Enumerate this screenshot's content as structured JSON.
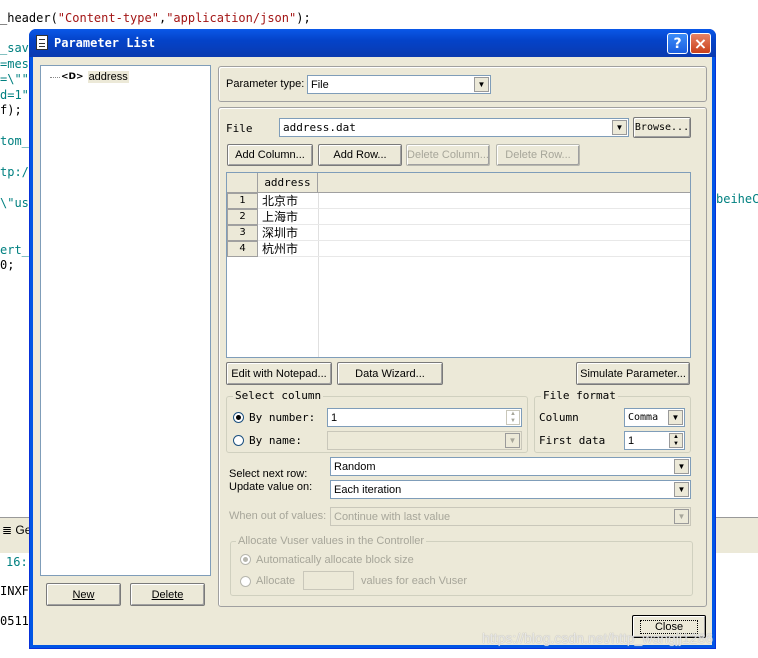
{
  "background_code": {
    "line1_prefix": "_header(",
    "line1_str1": "\"Content-type\"",
    "line1_comma": ",",
    "line1_str2": "\"application/json\"",
    "line1_suffix": ");",
    "lines": [
      "_sav",
      "=mes",
      "=\\\"\"",
      "d=1\"",
      "f);",
      "",
      "tom_",
      "",
      "tp:/",
      "",
      "\\\"us",
      "",
      "",
      "ert_",
      "0;"
    ],
    "right_fragment": "beiheC",
    "bottom_tab": "Ge",
    "bottom_num": "16:",
    "bottom_text1": "INXF",
    "bottom_text2": "0511"
  },
  "window": {
    "title": "Parameter List",
    "help_label": "?",
    "close_label": "×"
  },
  "tree": {
    "items": [
      {
        "icon_text": "<D>",
        "label": "address"
      }
    ]
  },
  "left_buttons": {
    "new": "New",
    "delete": "Delete"
  },
  "param_type": {
    "label": "Parameter type:",
    "value": "File"
  },
  "file": {
    "label": "File",
    "value": "address.dat",
    "browse": "Browse..."
  },
  "column_buttons": {
    "add_column": "Add Column...",
    "add_row": "Add Row...",
    "delete_column": "Delete Column...",
    "delete_row": "Delete Row..."
  },
  "table": {
    "header": "address",
    "rows": [
      {
        "num": "1",
        "value": "北京市"
      },
      {
        "num": "2",
        "value": "上海市"
      },
      {
        "num": "3",
        "value": "深圳市"
      },
      {
        "num": "4",
        "value": "杭州市"
      }
    ]
  },
  "action_buttons": {
    "edit_notepad": "Edit with Notepad...",
    "data_wizard": "Data Wizard...",
    "simulate": "Simulate Parameter..."
  },
  "select_column": {
    "title": "Select column",
    "by_number_label": "By number:",
    "by_number_value": "1",
    "by_name_label": "By name:"
  },
  "file_format": {
    "title": "File format",
    "column_label": "Column",
    "column_value": "Comma",
    "first_data_label": "First data",
    "first_data_value": "1"
  },
  "next_row": {
    "label": "Select next row:",
    "value": "Random"
  },
  "update_value": {
    "label": "Update value on:",
    "value": "Each iteration"
  },
  "out_of_values": {
    "label": "When out of values:",
    "value": "Continue with last value"
  },
  "allocate": {
    "title": "Allocate Vuser values in the Controller",
    "auto_label": "Automatically allocate block size",
    "allocate_label": "Allocate",
    "suffix_label": "values for each Vuser"
  },
  "close_button": "Close",
  "watermark": "https://blog.csdn.net/http_wangjj1286",
  "colors": {
    "title_bar": "#0a246a",
    "dialog_bg": "#ece9d8",
    "code_red": "#a31515",
    "code_teal": "#008080"
  }
}
